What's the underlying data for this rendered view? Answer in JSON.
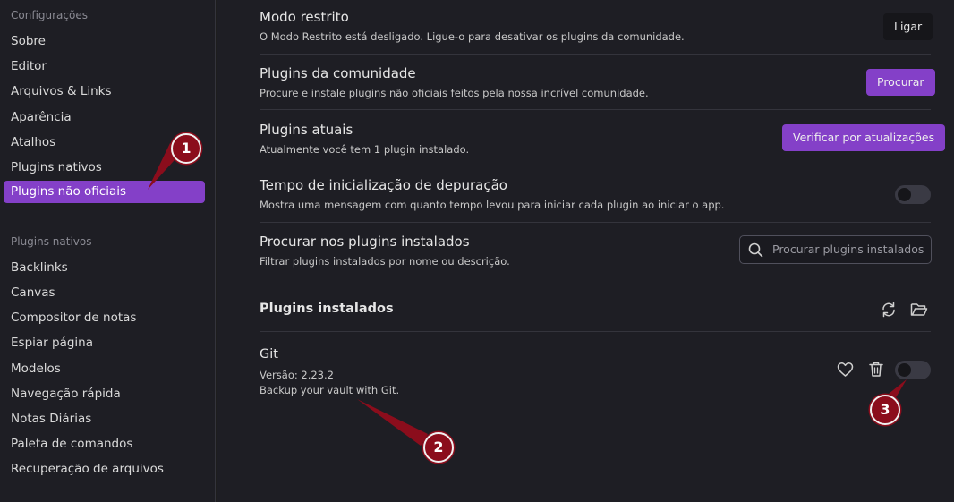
{
  "sidebar": {
    "settings_group_title": "Configurações",
    "settings_items": [
      {
        "label": "Sobre"
      },
      {
        "label": "Editor"
      },
      {
        "label": "Arquivos & Links"
      },
      {
        "label": "Aparência"
      },
      {
        "label": "Atalhos"
      },
      {
        "label": "Plugins nativos"
      },
      {
        "label": "Plugins não oficiais",
        "active": true
      }
    ],
    "core_group_title": "Plugins nativos",
    "core_items": [
      {
        "label": "Backlinks"
      },
      {
        "label": "Canvas"
      },
      {
        "label": "Compositor de notas"
      },
      {
        "label": "Espiar página"
      },
      {
        "label": "Modelos"
      },
      {
        "label": "Navegação rápida"
      },
      {
        "label": "Notas Diárias"
      },
      {
        "label": "Paleta de comandos"
      },
      {
        "label": "Recuperação de arquivos"
      }
    ]
  },
  "settings": {
    "restricted_mode": {
      "title": "Modo restrito",
      "description": "O Modo Restrito está desligado. Ligue-o para desativar os plugins da comunidade.",
      "button": "Ligar"
    },
    "community_plugins": {
      "title": "Plugins da comunidade",
      "description": "Procure e instale plugins não oficiais feitos pela nossa incrível comunidade.",
      "button": "Procurar"
    },
    "current_plugins": {
      "title": "Plugins atuais",
      "description": "Atualmente você tem 1 plugin instalado.",
      "button": "Verificar por atualizações"
    },
    "debug_startup": {
      "title": "Tempo de inicialização de depuração",
      "description": "Mostra uma mensagem com quanto tempo levou para iniciar cada plugin ao iniciar o app.",
      "toggle_on": false
    },
    "search_installed": {
      "title": "Procurar nos plugins instalados",
      "description": "Filtrar plugins instalados por nome ou descrição.",
      "placeholder": "Procurar plugins instalados",
      "value": ""
    }
  },
  "installed": {
    "heading": "Plugins instalados",
    "plugins": [
      {
        "name": "Git",
        "version": "Versão: 2.23.2",
        "description": "Backup your vault with Git.",
        "enabled": false
      }
    ]
  },
  "annotations": [
    "1",
    "2",
    "3"
  ],
  "colors": {
    "accent": "#8440c8",
    "annotation": "#8b0d1c"
  }
}
